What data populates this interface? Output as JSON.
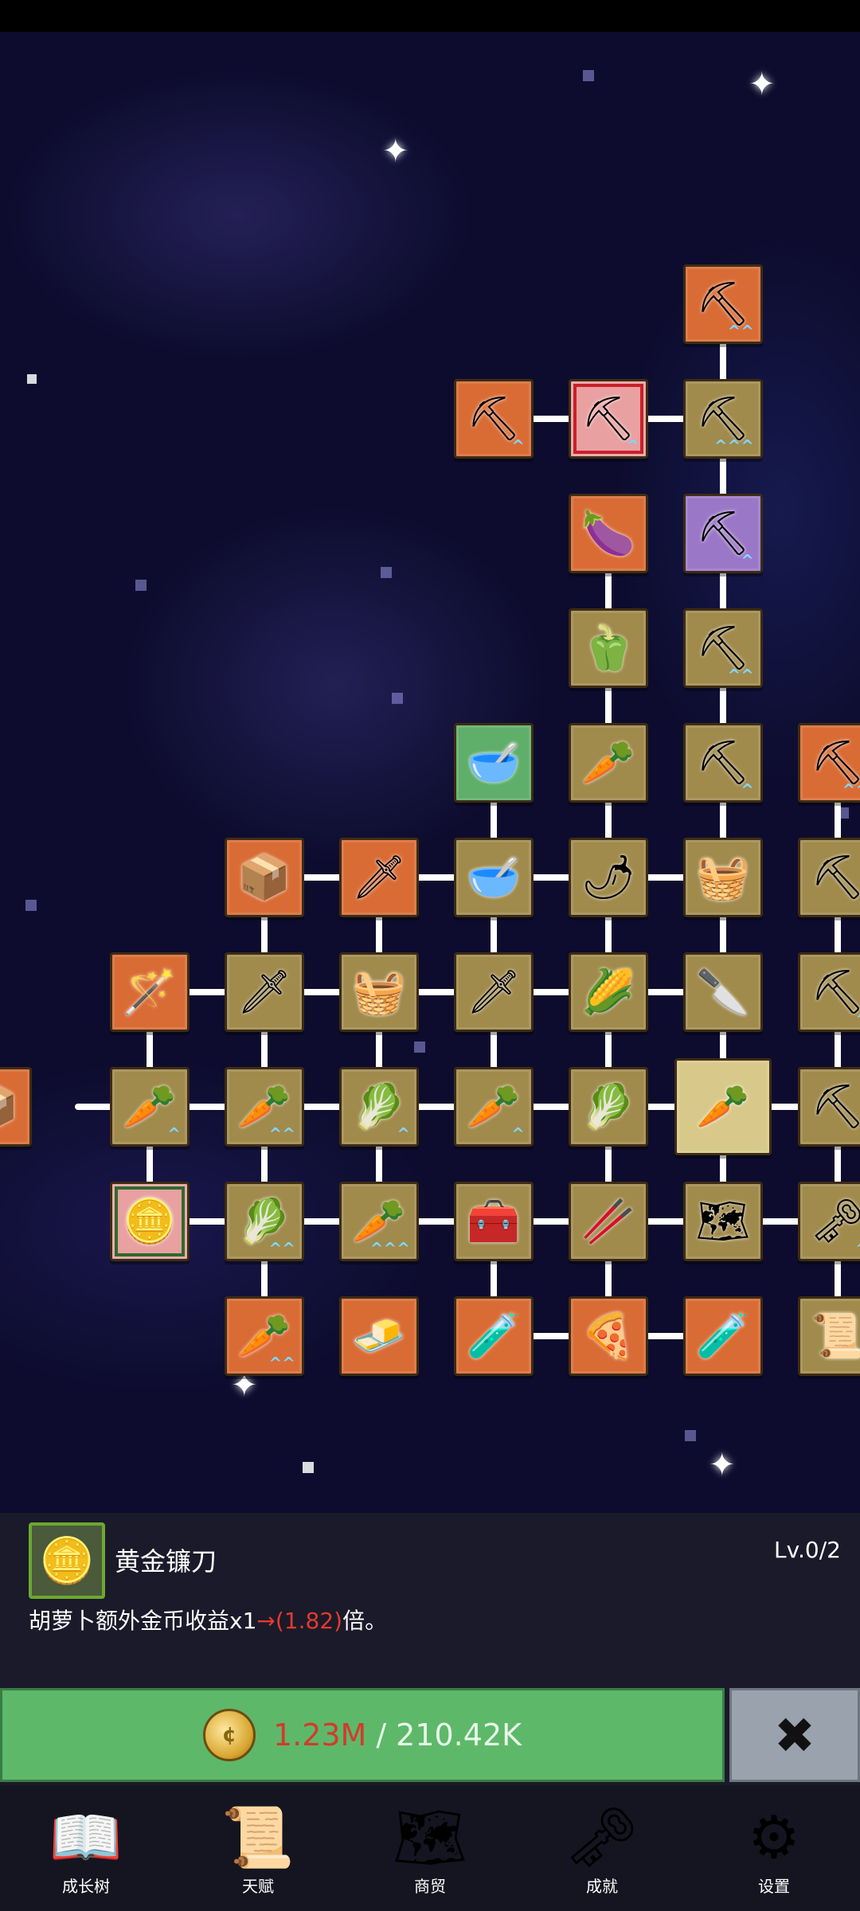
{
  "colors": {
    "node_orange": "#d96c35",
    "node_tan": "#a08a4c",
    "node_green": "#5fae6a",
    "node_highlight": "#d8c98a",
    "node_pink": "#e8a0a0",
    "node_purple": "#9b77c8",
    "buy_green": "#5eb86a",
    "close_gray": "#9aa2ad"
  },
  "selected_skill": {
    "icon": "gold-coin-icon",
    "name": "黄金镰刀",
    "level": "Lv.0/2",
    "desc_prefix": "胡萝卜额外金币收益x1",
    "desc_arrow": "→",
    "desc_value": "(1.82)",
    "desc_suffix": "倍。"
  },
  "purchase": {
    "current": "1.23M",
    "separator": "/",
    "required": "210.42K",
    "close_symbol": "✖"
  },
  "navbar": [
    {
      "label": "成长树",
      "icon": "book-icon"
    },
    {
      "label": "天赋",
      "icon": "scroll-icon"
    },
    {
      "label": "商贸",
      "icon": "map-icon"
    },
    {
      "label": "成就",
      "icon": "key-icon"
    },
    {
      "label": "设置",
      "icon": "gear-icon"
    }
  ],
  "tree_nodes": [
    {
      "icon": "shovel-icon",
      "glyph": "⛏",
      "bg": "orange",
      "chev": "^^"
    },
    {
      "icon": "shovel-icon",
      "glyph": "⛏",
      "bg": "orange",
      "chev": "^"
    },
    {
      "icon": "shovel-icon",
      "glyph": "⛏",
      "bg": "pink",
      "chev": "^",
      "sel": "red"
    },
    {
      "icon": "shovel-icon",
      "glyph": "⛏",
      "bg": "tan",
      "chev": "^^^"
    },
    {
      "icon": "eggplant-icon",
      "glyph": "🍆",
      "bg": "orange",
      "chev": ""
    },
    {
      "icon": "shovel-icon",
      "glyph": "⛏",
      "bg": "purple",
      "chev": "^"
    },
    {
      "icon": "bell-pepper-icon",
      "glyph": "🫑",
      "bg": "tan",
      "chev": ""
    },
    {
      "icon": "shovel-icon",
      "glyph": "⛏",
      "bg": "tan",
      "chev": "^^"
    },
    {
      "icon": "bowl-icon",
      "glyph": "🥣",
      "bg": "green",
      "chev": ""
    },
    {
      "icon": "radish-icon",
      "glyph": "🥕",
      "bg": "tan",
      "chev": ""
    },
    {
      "icon": "shovel-icon",
      "glyph": "⛏",
      "bg": "tan",
      "chev": "^"
    },
    {
      "icon": "pickaxe-icon",
      "glyph": "⛏",
      "bg": "orange",
      "chev": "^^"
    },
    {
      "icon": "crate-icon",
      "glyph": "📦",
      "bg": "orange",
      "chev": ""
    },
    {
      "icon": "sword-icon",
      "glyph": "🗡",
      "bg": "orange",
      "chev": ""
    },
    {
      "icon": "bowl-icon",
      "glyph": "🥣",
      "bg": "tan",
      "chev": ""
    },
    {
      "icon": "chili-icon",
      "glyph": "🌶",
      "bg": "tan",
      "chev": ""
    },
    {
      "icon": "basket-icon",
      "glyph": "🧺",
      "bg": "tan",
      "chev": ""
    },
    {
      "icon": "pickaxe-icon",
      "glyph": "⛏",
      "bg": "tan",
      "chev": ""
    },
    {
      "icon": "staff-icon",
      "glyph": "🪄",
      "bg": "orange",
      "chev": ""
    },
    {
      "icon": "sword-icon",
      "glyph": "🗡",
      "bg": "tan",
      "chev": ""
    },
    {
      "icon": "basket-icon",
      "glyph": "🧺",
      "bg": "tan",
      "chev": ""
    },
    {
      "icon": "sword-icon",
      "glyph": "🗡",
      "bg": "tan",
      "chev": ""
    },
    {
      "icon": "corn-icon",
      "glyph": "🌽",
      "bg": "tan",
      "chev": ""
    },
    {
      "icon": "dagger-icon",
      "glyph": "🔪",
      "bg": "tan",
      "chev": ""
    },
    {
      "icon": "pickaxe-icon",
      "glyph": "⛏",
      "bg": "tan",
      "chev": "^"
    },
    {
      "icon": "crate-icon",
      "glyph": "📦",
      "bg": "orange",
      "chev": ""
    },
    {
      "icon": "carrot-icon",
      "glyph": "🥕",
      "bg": "tan",
      "chev": "^"
    },
    {
      "icon": "carrot-icon",
      "glyph": "🥕",
      "bg": "tan",
      "chev": "^^"
    },
    {
      "icon": "cabbage-icon",
      "glyph": "🥬",
      "bg": "tan",
      "chev": "^"
    },
    {
      "icon": "carrot-icon",
      "glyph": "🥕",
      "bg": "tan",
      "chev": "^"
    },
    {
      "icon": "cabbage-icon",
      "glyph": "🥬",
      "bg": "tan",
      "chev": ""
    },
    {
      "icon": "carrot-icon",
      "glyph": "🥕",
      "bg": "highlight",
      "chev": "",
      "big": true
    },
    {
      "icon": "pickaxe-icon",
      "glyph": "⛏",
      "bg": "tan",
      "chev": ""
    },
    {
      "icon": "gold-coin-icon",
      "glyph": "🪙",
      "bg": "pink",
      "chev": "",
      "sel": "green"
    },
    {
      "icon": "cabbage-icon",
      "glyph": "🥬",
      "bg": "tan",
      "chev": "^^"
    },
    {
      "icon": "carrot-icon",
      "glyph": "🥕",
      "bg": "tan",
      "chev": "^^^"
    },
    {
      "icon": "treasure-chest-icon",
      "glyph": "🧰",
      "bg": "tan",
      "chev": ""
    },
    {
      "icon": "leek-icon",
      "glyph": "🥢",
      "bg": "tan",
      "chev": ""
    },
    {
      "icon": "map-icon",
      "glyph": "🗺",
      "bg": "tan",
      "chev": ""
    },
    {
      "icon": "key-icon",
      "glyph": "🗝",
      "bg": "tan",
      "chev": "^"
    },
    {
      "icon": "carrot-icon",
      "glyph": "🥕",
      "bg": "orange",
      "chev": "^^"
    },
    {
      "icon": "gold-bar-icon",
      "glyph": "🧈",
      "bg": "orange",
      "chev": ""
    },
    {
      "icon": "potion-icon",
      "glyph": "🧪",
      "bg": "orange",
      "chev": ""
    },
    {
      "icon": "pizza-icon",
      "glyph": "🍕",
      "bg": "orange",
      "chev": ""
    },
    {
      "icon": "potion-icon",
      "glyph": "🧪",
      "bg": "orange",
      "chev": ""
    },
    {
      "icon": "scroll-icon",
      "glyph": "📜",
      "bg": "tan",
      "chev": ""
    }
  ]
}
